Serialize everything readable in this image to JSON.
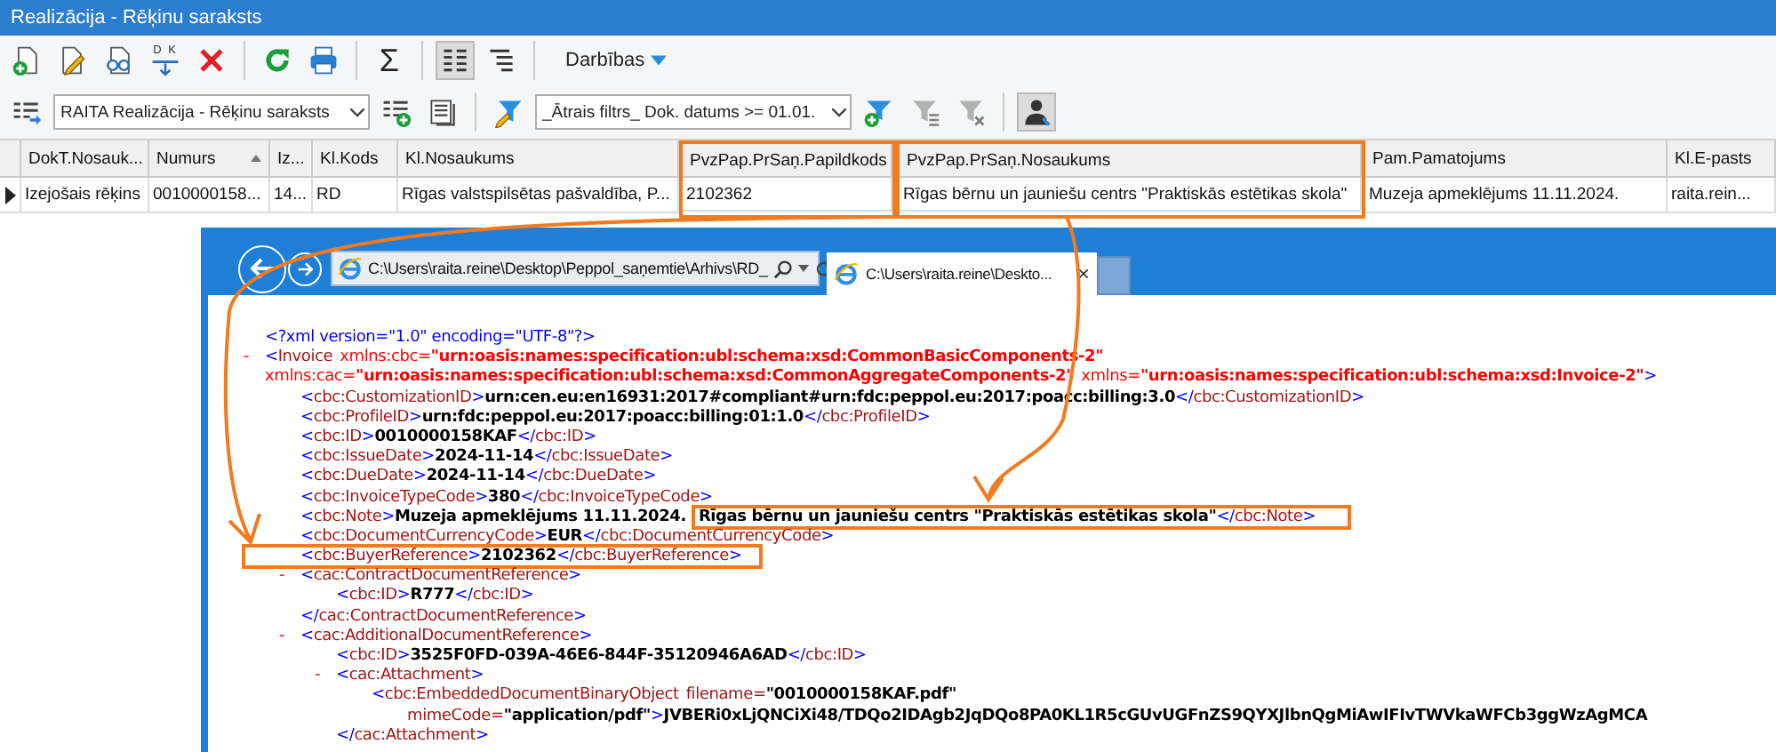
{
  "window": {
    "title": "Realizācija - Rēķinu saraksts"
  },
  "toolbar": [
    {
      "kind": "new"
    },
    {
      "kind": "edit"
    },
    {
      "kind": "preview"
    },
    {
      "kind": "split",
      "label": "D K"
    },
    {
      "kind": "delete"
    },
    {
      "kind": "separator"
    },
    {
      "kind": "refresh"
    },
    {
      "kind": "print"
    },
    {
      "kind": "separator"
    },
    {
      "kind": "sum",
      "label": "Σ"
    },
    {
      "kind": "separator"
    },
    {
      "kind": "list-view",
      "selected": true
    },
    {
      "kind": "tree-view",
      "selected": false
    },
    {
      "kind": "separator"
    },
    {
      "kind": "menu",
      "label": "Darbības"
    }
  ],
  "filter_bar": [
    {
      "kind": "layout"
    },
    {
      "kind": "combo",
      "value": "RAITA Realizācija - Rēķinu saraksts"
    },
    {
      "kind": "add-layout"
    },
    {
      "kind": "layout-list"
    },
    {
      "kind": "separator"
    },
    {
      "kind": "filter-edit"
    },
    {
      "kind": "combo",
      "value": "_Ātrais filtrs_ Dok. datums >= 01.01."
    },
    {
      "kind": "filter-add",
      "disabled": false
    },
    {
      "kind": "filter-remove",
      "disabled": true
    },
    {
      "kind": "filter-clear",
      "disabled": true
    },
    {
      "kind": "separator"
    },
    {
      "kind": "user-filter",
      "selected": true
    }
  ],
  "grid": {
    "columns": [
      {
        "label": "DokT.Nosauk...",
        "sorted": false,
        "highlighted": false
      },
      {
        "label": "Numurs",
        "sorted": true,
        "highlighted": false
      },
      {
        "label": "Iz...",
        "sorted": false,
        "highlighted": false
      },
      {
        "label": "Kl.Kods",
        "sorted": false,
        "highlighted": false
      },
      {
        "label": "Kl.Nosaukums",
        "sorted": false,
        "highlighted": false
      },
      {
        "label": "PvzPap.PrSaņ.Papildkods",
        "sorted": false,
        "highlighted": true
      },
      {
        "label": "PvzPap.PrSaņ.Nosaukums",
        "sorted": false,
        "highlighted": true
      },
      {
        "label": "Pam.Pamatojums",
        "sorted": false,
        "highlighted": false
      },
      {
        "label": "Kl.E-pasts",
        "sorted": false,
        "highlighted": false
      }
    ],
    "rows": [
      {
        "current": true,
        "cells": [
          "Izejošais rēķins",
          "0010000158...",
          "14...",
          "RD",
          "Rīgas valstspilsētas pašvaldība, P...",
          "2102362",
          "Rīgas bērnu un jauniešu centrs \"Praktiskās estētikas skola\"",
          "Muzeja apmeklējums 11.11.2024.",
          "raita.rein..."
        ]
      }
    ]
  },
  "browser": {
    "address": "C:\\Users\\raita.reine\\Desktop\\Peppol_saņemtie\\Arhivs\\RD_",
    "tabs": [
      {
        "label": "C:\\Users\\raita.reine\\Deskto...",
        "close": "×",
        "selected": true
      }
    ],
    "xml": [
      {
        "head": [
          [
            {
              "kind": "pi",
              "text": "<?xml version=\"1.0\" encoding=\"UTF-8\"?>"
            }
          ]
        ]
      },
      {
        "toggle": "-",
        "head": [
          [
            {
              "kind": "tag",
              "text": "<Invoice"
            },
            {
              "kind": "ns-attr",
              "text": "xmlns:cbc="
            },
            {
              "kind": "ns-value",
              "text": "\"urn:oasis:names:specification:ubl:schema:xsd:CommonBasicComponents-2\""
            }
          ],
          [
            {
              "kind": "ns-attr",
              "text": "xmlns:cac="
            },
            {
              "kind": "ns-value",
              "text": "\"urn:oasis:names:specification:ubl:schema:xsd:CommonAggregateComponents-2\""
            },
            {
              "kind": "ns-attr",
              "text": "xmlns="
            },
            {
              "kind": "ns-value",
              "text": "\"urn:oasis:names:specification:ubl:schema:xsd:Invoice-2\""
            },
            {
              "kind": "tag",
              "text": ">"
            }
          ]
        ],
        "children": [
          {
            "head": [
              [
                {
                  "kind": "tag",
                  "text": "<cbc:CustomizationID>"
                },
                {
                  "kind": "value",
                  "text": "urn:cen.eu:en16931:2017#compliant#urn:fdc:peppol.eu:2017:poacc:billing:3.0"
                },
                {
                  "kind": "tag",
                  "text": "</cbc:CustomizationID>"
                }
              ]
            ]
          },
          {
            "head": [
              [
                {
                  "kind": "tag",
                  "text": "<cbc:ProfileID>"
                },
                {
                  "kind": "value",
                  "text": "urn:fdc:peppol.eu:2017:poacc:billing:01:1.0"
                },
                {
                  "kind": "tag",
                  "text": "</cbc:ProfileID>"
                }
              ]
            ]
          },
          {
            "head": [
              [
                {
                  "kind": "tag",
                  "text": "<cbc:ID>"
                },
                {
                  "kind": "value",
                  "text": "0010000158KAF"
                },
                {
                  "kind": "tag",
                  "text": "</cbc:ID>"
                }
              ]
            ]
          },
          {
            "head": [
              [
                {
                  "kind": "tag",
                  "text": "<cbc:IssueDate>"
                },
                {
                  "kind": "value",
                  "text": "2024-11-14"
                },
                {
                  "kind": "tag",
                  "text": "</cbc:IssueDate>"
                }
              ]
            ]
          },
          {
            "head": [
              [
                {
                  "kind": "tag",
                  "text": "<cbc:DueDate>"
                },
                {
                  "kind": "value",
                  "text": "2024-11-14"
                },
                {
                  "kind": "tag",
                  "text": "</cbc:DueDate>"
                }
              ]
            ]
          },
          {
            "head": [
              [
                {
                  "kind": "tag",
                  "text": "<cbc:InvoiceTypeCode>"
                },
                {
                  "kind": "value",
                  "text": "380"
                },
                {
                  "kind": "tag",
                  "text": "</cbc:InvoiceTypeCode>"
                }
              ]
            ]
          },
          {
            "head": [
              [
                {
                  "kind": "tag",
                  "text": "<cbc:Note>"
                },
                {
                  "kind": "value",
                  "text": "Muzeja apmeklējums 11.11.2024."
                },
                {
                  "kind": "value",
                  "text": "Rīgas bērnu un jauniešu centrs \"Praktiskās estētikas skola\"",
                  "framed": true
                },
                {
                  "kind": "tag",
                  "text": "</cbc:Note>",
                  "framed": true
                }
              ]
            ]
          },
          {
            "head": [
              [
                {
                  "kind": "tag",
                  "text": "<cbc:DocumentCurrencyCode>"
                },
                {
                  "kind": "value",
                  "text": "EUR"
                },
                {
                  "kind": "tag",
                  "text": "</cbc:DocumentCurrencyCode>"
                }
              ]
            ]
          },
          {
            "head": [
              [
                {
                  "kind": "tag",
                  "text": "<cbc:BuyerReference>",
                  "framed": true
                },
                {
                  "kind": "value",
                  "text": "2102362",
                  "framed": true
                },
                {
                  "kind": "tag",
                  "text": "</cbc:BuyerReference>",
                  "framed": true
                }
              ]
            ]
          },
          {
            "toggle": "-",
            "head": [
              [
                {
                  "kind": "tag",
                  "text": "<cac:ContractDocumentReference>"
                }
              ]
            ],
            "children": [
              {
                "head": [
                  [
                    {
                      "kind": "tag",
                      "text": "<cbc:ID>"
                    },
                    {
                      "kind": "value",
                      "text": "R777"
                    },
                    {
                      "kind": "tag",
                      "text": "</cbc:ID>"
                    }
                  ]
                ]
              }
            ],
            "tail": [
              {
                "kind": "tag",
                "text": "</cac:ContractDocumentReference>"
              }
            ]
          },
          {
            "toggle": "-",
            "head": [
              [
                {
                  "kind": "tag",
                  "text": "<cac:AdditionalDocumentReference>"
                }
              ]
            ],
            "children": [
              {
                "head": [
                  [
                    {
                      "kind": "tag",
                      "text": "<cbc:ID>"
                    },
                    {
                      "kind": "value",
                      "text": "3525F0FD-039A-46E6-844F-35120946A6AD"
                    },
                    {
                      "kind": "tag",
                      "text": "</cbc:ID>"
                    }
                  ]
                ]
              },
              {
                "toggle": "-",
                "head": [
                  [
                    {
                      "kind": "tag",
                      "text": "<cac:Attachment>"
                    }
                  ]
                ],
                "children": [
                  {
                    "head": [
                      [
                        {
                          "kind": "tag",
                          "text": "<cbc:EmbeddedDocumentBinaryObject"
                        },
                        {
                          "kind": "attr",
                          "text": "filename="
                        },
                        {
                          "kind": "value",
                          "text": "\"0010000158KAF.pdf\""
                        }
                      ],
                      [
                        {
                          "kind": "attr",
                          "text": "mimeCode="
                        },
                        {
                          "kind": "value",
                          "text": "\"application/pdf\""
                        },
                        {
                          "kind": "tag",
                          "text": ">"
                        },
                        {
                          "kind": "value",
                          "text": "JVBERi0xLjQNCiXi48/TDQo2IDAgb2JqDQo8PA0KL1R5cGUvUGFnZS9QYXJlbnQgMiAwIFIvTWVkaWFCb3ggWzAgMCA"
                        }
                      ]
                    ]
                  }
                ],
                "tail": [
                  {
                    "kind": "tag",
                    "text": "</cac:Attachment>"
                  }
                ]
              }
            ]
          }
        ]
      }
    ]
  }
}
